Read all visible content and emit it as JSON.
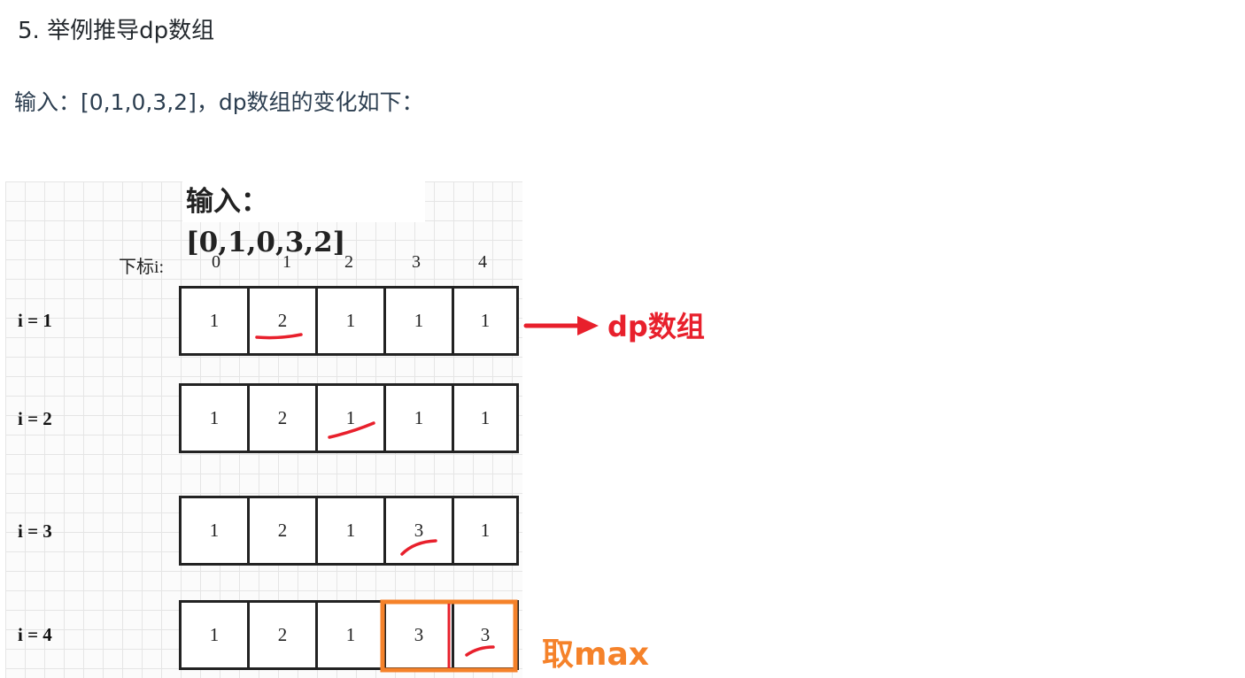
{
  "heading": "5. 举例推导dp数组",
  "paragraph": "输入：[0,1,0,3,2]，dp数组的变化如下：",
  "figure": {
    "title": "输入：[0,1,0,3,2]",
    "index_label": "下标i:",
    "indices": [
      "0",
      "1",
      "2",
      "3",
      "4"
    ],
    "rows": [
      {
        "label": "i = 1",
        "values": [
          "1",
          "2",
          "1",
          "1",
          "1"
        ]
      },
      {
        "label": "i = 2",
        "values": [
          "1",
          "2",
          "1",
          "1",
          "1"
        ]
      },
      {
        "label": "i = 3",
        "values": [
          "1",
          "2",
          "1",
          "3",
          "1"
        ]
      },
      {
        "label": "i = 4",
        "values": [
          "1",
          "2",
          "1",
          "3",
          "3"
        ]
      }
    ]
  },
  "annotations": {
    "dp_label": "dp数组",
    "max_label": "取max",
    "red_color": "#e8202c",
    "orange_color": "#f5822a"
  }
}
